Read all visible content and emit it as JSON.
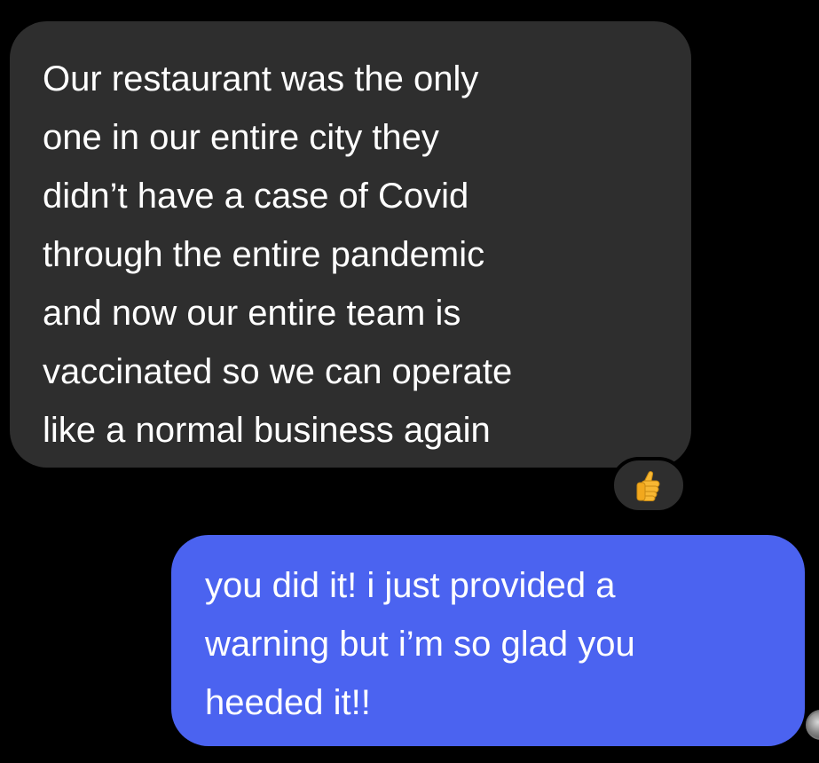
{
  "messages": [
    {
      "direction": "incoming",
      "lines": [
        "Our restaurant was the only",
        "one in our entire city they",
        "didn’t have a case of Covid",
        "through the entire pandemic",
        "and now our entire team is",
        "vaccinated so we can operate",
        "like a normal business again"
      ],
      "reaction": {
        "icon": "thumbs-up-icon",
        "color": "#f7b733"
      }
    },
    {
      "direction": "outgoing",
      "lines": [
        "you did it! i just provided a",
        "warning but i’m so glad you",
        "heeded it!!"
      ]
    }
  ],
  "colors": {
    "background": "#000000",
    "incoming_bubble": "#2e2e2e",
    "outgoing_bubble": "#4b63f0",
    "text": "#ffffff"
  },
  "avatar": {
    "icon": "user-avatar-icon"
  }
}
